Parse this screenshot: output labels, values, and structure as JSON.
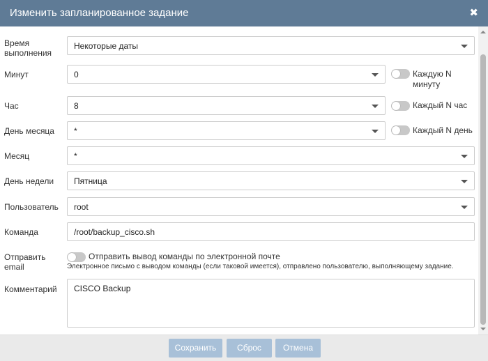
{
  "dialog": {
    "title": "Изменить запланированное задание",
    "close_symbol": "✖"
  },
  "labels": {
    "time": [
      "Время",
      "выполнения"
    ],
    "minute": "Минут",
    "hour": "Час",
    "day_of_month": "День месяца",
    "month": "Месяц",
    "day_of_week": "День недели",
    "user": "Пользователь",
    "command": "Команда",
    "send_email": [
      "Отправить",
      "email"
    ],
    "comment": "Комментарий"
  },
  "fields": {
    "time": "Некоторые даты",
    "minute": "0",
    "hour": "8",
    "day_of_month": "*",
    "month": "*",
    "day_of_week": "Пятница",
    "user": "root",
    "command": "/root/backup_cisco.sh",
    "comment": "CISCO Backup"
  },
  "toggles": {
    "every_n_minute": [
      "Каждую N",
      "минуту"
    ],
    "every_n_hour": "Каждый N час",
    "every_n_day": "Каждый N день",
    "send_email": "Отправить вывод команды по электронной почте",
    "send_email_note": "Электронное письмо с выводом команды (если таковой имеется), отправлено пользователю, выполняющему задание."
  },
  "buttons": {
    "save": "Сохранить",
    "reset": "Сброс",
    "cancel": "Отмена"
  },
  "colors": {
    "titlebar": "#5f7b96",
    "button": "#a8c0d8",
    "footer": "#eaeaea"
  }
}
